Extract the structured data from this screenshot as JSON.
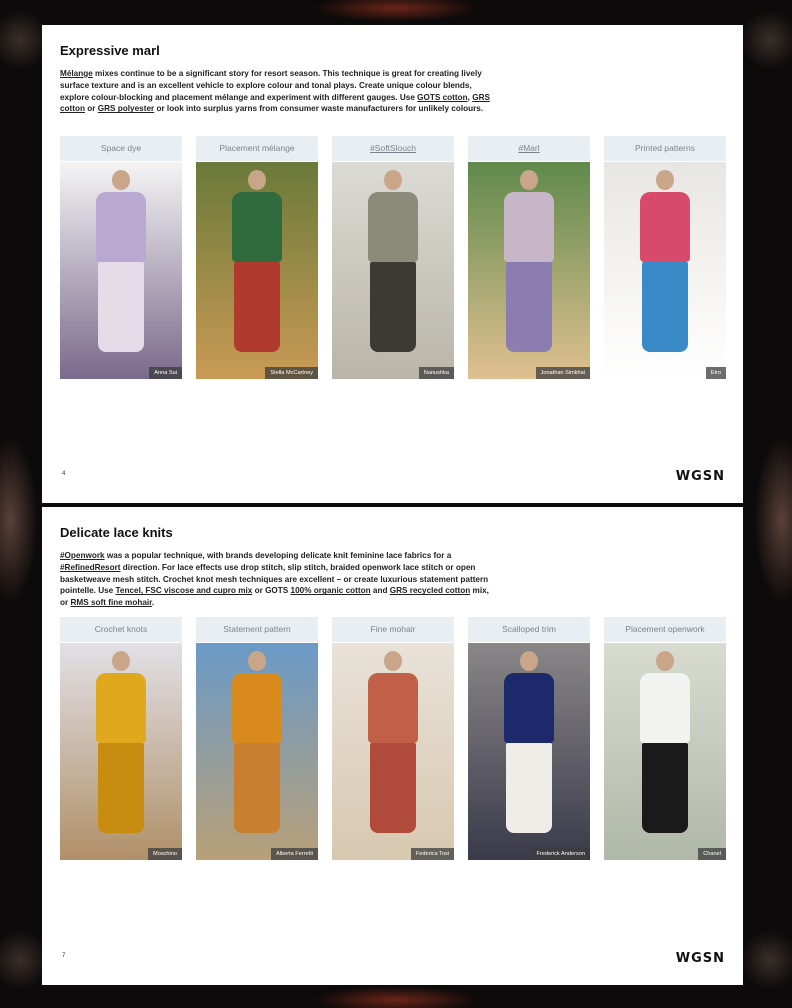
{
  "pages": [
    {
      "title": "Expressive marl",
      "body_segments": [
        {
          "text": "Mélange",
          "link": true
        },
        {
          "text": " mixes continue to be a significant story for resort season. This technique is great for creating lively surface texture and is an excellent vehicle to explore colour and tonal plays. Create unique colour blends, explore colour-blocking and placement mélange and experiment with different gauges. Use ",
          "link": false
        },
        {
          "text": "GOTS cotton",
          "link": true
        },
        {
          "text": ", ",
          "link": false
        },
        {
          "text": "GRS cotton",
          "link": true
        },
        {
          "text": " or ",
          "link": false
        },
        {
          "text": "GRS polyester",
          "link": true
        },
        {
          "text": " or look into surplus yarns from consumer waste manufacturers for unlikely colours.",
          "link": false
        }
      ],
      "columns": [
        {
          "label": "Space dye",
          "credit": "Anna Sui",
          "link": false
        },
        {
          "label": "Placement mélange",
          "credit": "Stella McCartney",
          "link": false
        },
        {
          "label": "#SoftSlouch",
          "credit": "Nanushka",
          "link": true
        },
        {
          "label": "#Marl",
          "credit": "Jonathan Simkhai",
          "link": true
        },
        {
          "label": "Printed patterns",
          "credit": "Etro",
          "link": false
        }
      ],
      "page_number": "4",
      "logo": "WGSN"
    },
    {
      "title": "Delicate lace knits",
      "body_segments": [
        {
          "text": "#Openwork",
          "link": true
        },
        {
          "text": " was a popular technique, with brands developing delicate knit feminine lace fabrics for a ",
          "link": false
        },
        {
          "text": "#RefinedResort",
          "link": true
        },
        {
          "text": " direction. For lace effects use drop stitch, slip stitch, braided openwork lace stitch or open basketweave mesh stitch. Crochet knot mesh techniques are excellent – or create luxurious statement pattern pointelle. Use ",
          "link": false
        },
        {
          "text": "Tencel, FSC viscose and cupro mix",
          "link": true
        },
        {
          "text": " or GOTS ",
          "link": false
        },
        {
          "text": "100% organic cotton",
          "link": true
        },
        {
          "text": " and ",
          "link": false
        },
        {
          "text": "GRS recycled cotton",
          "link": true
        },
        {
          "text": " mix, or ",
          "link": false
        },
        {
          "text": "RMS soft fine mohair",
          "link": true
        },
        {
          "text": ".",
          "link": false
        }
      ],
      "columns": [
        {
          "label": "Crochet knots",
          "credit": "Moschino",
          "link": false
        },
        {
          "label": "Statement pattern",
          "credit": "Alberta Ferretti",
          "link": false
        },
        {
          "label": "Fine mohair",
          "credit": "Federica Tosi",
          "link": false
        },
        {
          "label": "Scalloped trim",
          "credit": "Frederick Anderson",
          "link": false
        },
        {
          "label": "Placement openwork",
          "credit": "Chanel",
          "link": false
        }
      ],
      "page_number": "7",
      "logo": "WGSN"
    }
  ],
  "colors": {
    "label_bg": "#e9eef2",
    "label_text": "#7a8590",
    "page_bg": "#ffffff",
    "backdrop": "#0c0a0a"
  },
  "photo_palettes": [
    [
      "#f4f4f4",
      "#b9a8d0",
      "#e6dce8",
      "#7a6a8c"
    ],
    [
      "#6a7a3a",
      "#2f6b3c",
      "#b03a2e",
      "#c99a54"
    ],
    [
      "#dcdad4",
      "#8c8a78",
      "#3d3a34",
      "#b9b5a8"
    ],
    [
      "#5f8a4c",
      "#c7b6c8",
      "#8b7db0",
      "#e0c090"
    ],
    [
      "#e8e6e2",
      "#d84a6a",
      "#3a8ac8",
      "#ffffff"
    ],
    [
      "#e2e0e6",
      "#e0a81c",
      "#c78c10",
      "#b09068"
    ],
    [
      "#6a9ac8",
      "#d88a1c",
      "#c88030",
      "#b8a078"
    ],
    [
      "#e8e2d8",
      "#c06048",
      "#b04a3a",
      "#d8c8b0"
    ],
    [
      "#8a8688",
      "#1c2a6c",
      "#f0ece8",
      "#3a3a4a"
    ],
    [
      "#d8dcd0",
      "#f2f2f0",
      "#1a1a1a",
      "#b0b8a8"
    ]
  ]
}
